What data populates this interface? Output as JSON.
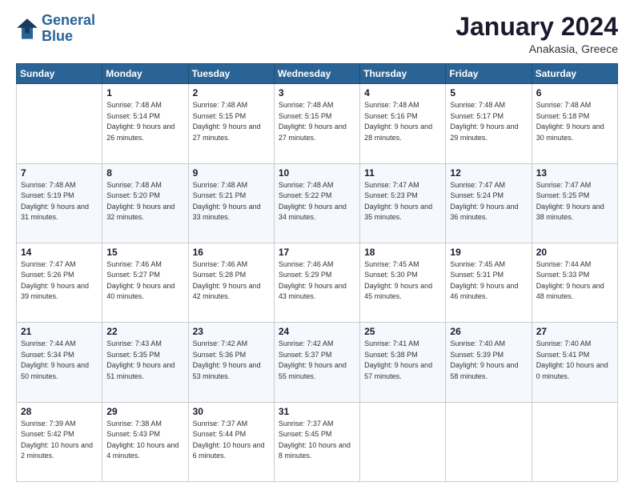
{
  "header": {
    "logo_line1": "General",
    "logo_line2": "Blue",
    "month_title": "January 2024",
    "subtitle": "Anakasia, Greece"
  },
  "columns": [
    "Sunday",
    "Monday",
    "Tuesday",
    "Wednesday",
    "Thursday",
    "Friday",
    "Saturday"
  ],
  "weeks": [
    [
      {
        "day": "",
        "sunrise": "",
        "sunset": "",
        "daylight": ""
      },
      {
        "day": "1",
        "sunrise": "Sunrise: 7:48 AM",
        "sunset": "Sunset: 5:14 PM",
        "daylight": "Daylight: 9 hours and 26 minutes."
      },
      {
        "day": "2",
        "sunrise": "Sunrise: 7:48 AM",
        "sunset": "Sunset: 5:15 PM",
        "daylight": "Daylight: 9 hours and 27 minutes."
      },
      {
        "day": "3",
        "sunrise": "Sunrise: 7:48 AM",
        "sunset": "Sunset: 5:15 PM",
        "daylight": "Daylight: 9 hours and 27 minutes."
      },
      {
        "day": "4",
        "sunrise": "Sunrise: 7:48 AM",
        "sunset": "Sunset: 5:16 PM",
        "daylight": "Daylight: 9 hours and 28 minutes."
      },
      {
        "day": "5",
        "sunrise": "Sunrise: 7:48 AM",
        "sunset": "Sunset: 5:17 PM",
        "daylight": "Daylight: 9 hours and 29 minutes."
      },
      {
        "day": "6",
        "sunrise": "Sunrise: 7:48 AM",
        "sunset": "Sunset: 5:18 PM",
        "daylight": "Daylight: 9 hours and 30 minutes."
      }
    ],
    [
      {
        "day": "7",
        "sunrise": "Sunrise: 7:48 AM",
        "sunset": "Sunset: 5:19 PM",
        "daylight": "Daylight: 9 hours and 31 minutes."
      },
      {
        "day": "8",
        "sunrise": "Sunrise: 7:48 AM",
        "sunset": "Sunset: 5:20 PM",
        "daylight": "Daylight: 9 hours and 32 minutes."
      },
      {
        "day": "9",
        "sunrise": "Sunrise: 7:48 AM",
        "sunset": "Sunset: 5:21 PM",
        "daylight": "Daylight: 9 hours and 33 minutes."
      },
      {
        "day": "10",
        "sunrise": "Sunrise: 7:48 AM",
        "sunset": "Sunset: 5:22 PM",
        "daylight": "Daylight: 9 hours and 34 minutes."
      },
      {
        "day": "11",
        "sunrise": "Sunrise: 7:47 AM",
        "sunset": "Sunset: 5:23 PM",
        "daylight": "Daylight: 9 hours and 35 minutes."
      },
      {
        "day": "12",
        "sunrise": "Sunrise: 7:47 AM",
        "sunset": "Sunset: 5:24 PM",
        "daylight": "Daylight: 9 hours and 36 minutes."
      },
      {
        "day": "13",
        "sunrise": "Sunrise: 7:47 AM",
        "sunset": "Sunset: 5:25 PM",
        "daylight": "Daylight: 9 hours and 38 minutes."
      }
    ],
    [
      {
        "day": "14",
        "sunrise": "Sunrise: 7:47 AM",
        "sunset": "Sunset: 5:26 PM",
        "daylight": "Daylight: 9 hours and 39 minutes."
      },
      {
        "day": "15",
        "sunrise": "Sunrise: 7:46 AM",
        "sunset": "Sunset: 5:27 PM",
        "daylight": "Daylight: 9 hours and 40 minutes."
      },
      {
        "day": "16",
        "sunrise": "Sunrise: 7:46 AM",
        "sunset": "Sunset: 5:28 PM",
        "daylight": "Daylight: 9 hours and 42 minutes."
      },
      {
        "day": "17",
        "sunrise": "Sunrise: 7:46 AM",
        "sunset": "Sunset: 5:29 PM",
        "daylight": "Daylight: 9 hours and 43 minutes."
      },
      {
        "day": "18",
        "sunrise": "Sunrise: 7:45 AM",
        "sunset": "Sunset: 5:30 PM",
        "daylight": "Daylight: 9 hours and 45 minutes."
      },
      {
        "day": "19",
        "sunrise": "Sunrise: 7:45 AM",
        "sunset": "Sunset: 5:31 PM",
        "daylight": "Daylight: 9 hours and 46 minutes."
      },
      {
        "day": "20",
        "sunrise": "Sunrise: 7:44 AM",
        "sunset": "Sunset: 5:33 PM",
        "daylight": "Daylight: 9 hours and 48 minutes."
      }
    ],
    [
      {
        "day": "21",
        "sunrise": "Sunrise: 7:44 AM",
        "sunset": "Sunset: 5:34 PM",
        "daylight": "Daylight: 9 hours and 50 minutes."
      },
      {
        "day": "22",
        "sunrise": "Sunrise: 7:43 AM",
        "sunset": "Sunset: 5:35 PM",
        "daylight": "Daylight: 9 hours and 51 minutes."
      },
      {
        "day": "23",
        "sunrise": "Sunrise: 7:42 AM",
        "sunset": "Sunset: 5:36 PM",
        "daylight": "Daylight: 9 hours and 53 minutes."
      },
      {
        "day": "24",
        "sunrise": "Sunrise: 7:42 AM",
        "sunset": "Sunset: 5:37 PM",
        "daylight": "Daylight: 9 hours and 55 minutes."
      },
      {
        "day": "25",
        "sunrise": "Sunrise: 7:41 AM",
        "sunset": "Sunset: 5:38 PM",
        "daylight": "Daylight: 9 hours and 57 minutes."
      },
      {
        "day": "26",
        "sunrise": "Sunrise: 7:40 AM",
        "sunset": "Sunset: 5:39 PM",
        "daylight": "Daylight: 9 hours and 58 minutes."
      },
      {
        "day": "27",
        "sunrise": "Sunrise: 7:40 AM",
        "sunset": "Sunset: 5:41 PM",
        "daylight": "Daylight: 10 hours and 0 minutes."
      }
    ],
    [
      {
        "day": "28",
        "sunrise": "Sunrise: 7:39 AM",
        "sunset": "Sunset: 5:42 PM",
        "daylight": "Daylight: 10 hours and 2 minutes."
      },
      {
        "day": "29",
        "sunrise": "Sunrise: 7:38 AM",
        "sunset": "Sunset: 5:43 PM",
        "daylight": "Daylight: 10 hours and 4 minutes."
      },
      {
        "day": "30",
        "sunrise": "Sunrise: 7:37 AM",
        "sunset": "Sunset: 5:44 PM",
        "daylight": "Daylight: 10 hours and 6 minutes."
      },
      {
        "day": "31",
        "sunrise": "Sunrise: 7:37 AM",
        "sunset": "Sunset: 5:45 PM",
        "daylight": "Daylight: 10 hours and 8 minutes."
      },
      {
        "day": "",
        "sunrise": "",
        "sunset": "",
        "daylight": ""
      },
      {
        "day": "",
        "sunrise": "",
        "sunset": "",
        "daylight": ""
      },
      {
        "day": "",
        "sunrise": "",
        "sunset": "",
        "daylight": ""
      }
    ]
  ]
}
